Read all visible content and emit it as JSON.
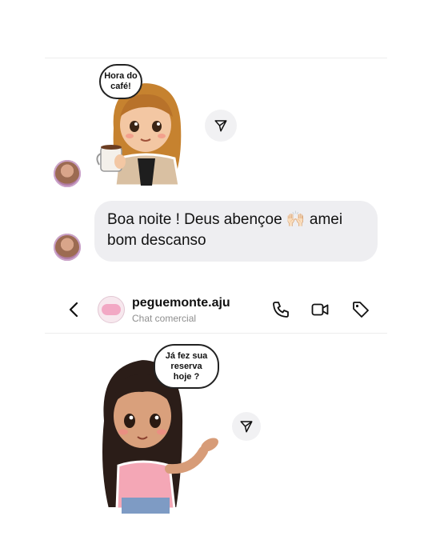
{
  "sticker_top": {
    "speech_text": "Hora do café!"
  },
  "message": {
    "text": "Boa noite ! Deus abençoe 🙌🏻 amei bom descanso"
  },
  "header": {
    "username": "peguemonte.aju",
    "subtitle": "Chat comercial"
  },
  "sticker_bottom": {
    "speech_text": "Já fez sua reserva hoje ?"
  },
  "icons": [
    "send-icon",
    "back-chevron-icon",
    "phone-icon",
    "video-icon",
    "tag-icon"
  ]
}
